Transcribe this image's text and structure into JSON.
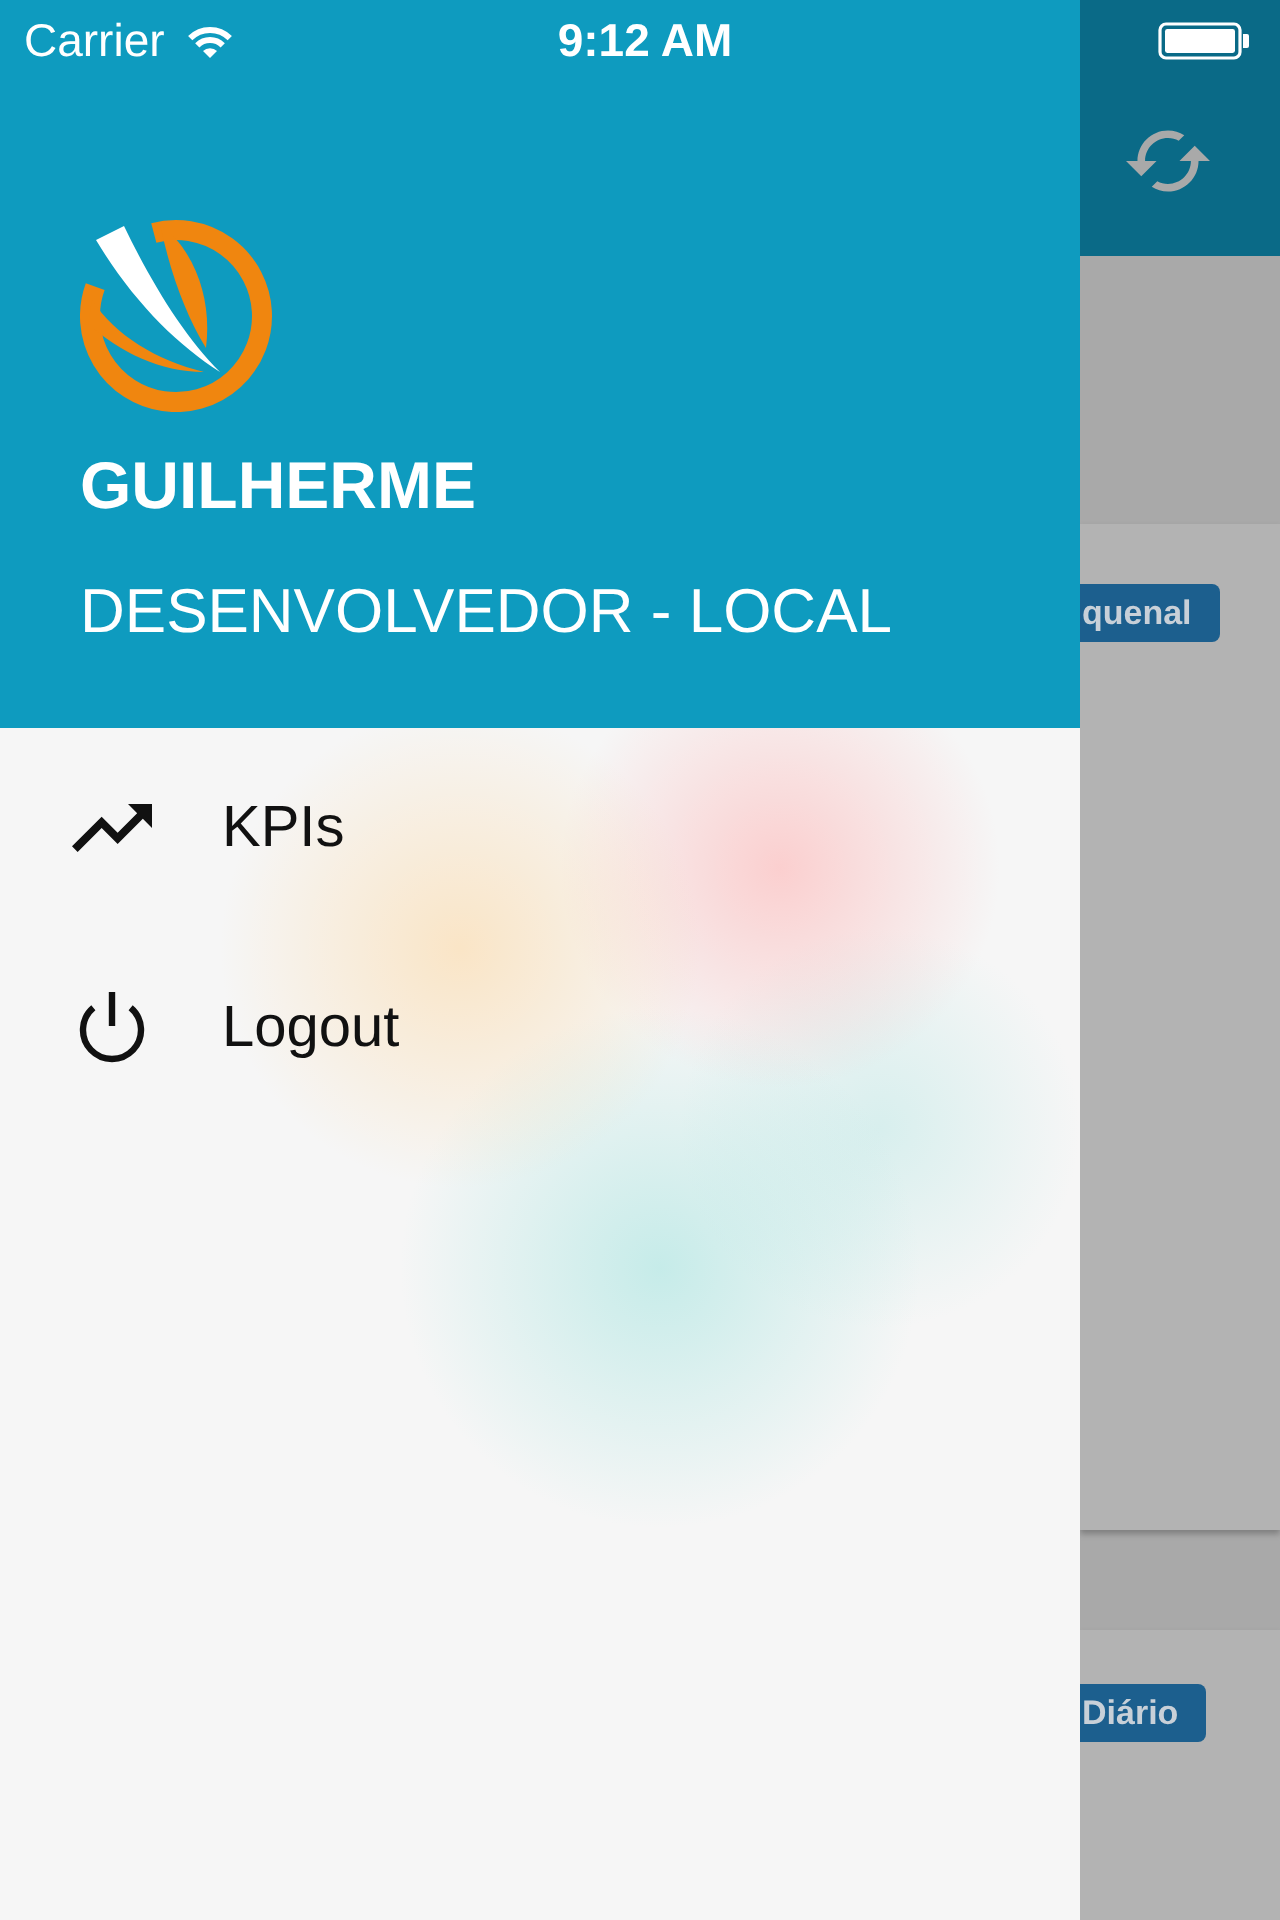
{
  "status_bar": {
    "carrier": "Carrier",
    "time": "9:12 AM"
  },
  "drawer": {
    "user_name": "GUILHERME",
    "user_role": "DESENVOLVEDOR - LOCAL",
    "menu": [
      {
        "kind": "chart",
        "label": "KPIs"
      },
      {
        "kind": "power",
        "label": "Logout"
      }
    ]
  },
  "background_screen": {
    "cards": [
      {
        "badge": "quenal"
      },
      {
        "badge": "Diário"
      }
    ]
  }
}
